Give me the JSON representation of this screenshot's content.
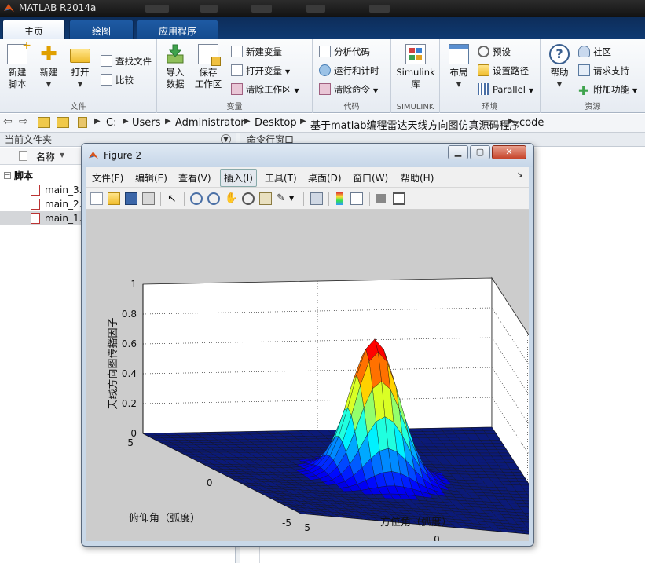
{
  "app": {
    "title": "MATLAB R2014a"
  },
  "tabs": [
    {
      "label": "主页"
    },
    {
      "label": "绘图"
    },
    {
      "label": "应用程序"
    }
  ],
  "ribbon": {
    "file": {
      "label": "文件",
      "new_script": "新建\n脚本",
      "new": "新建",
      "open": "打开",
      "find_files": "查找文件",
      "compare": "比较"
    },
    "variable": {
      "label": "变量",
      "import": "导入\n数据",
      "save_ws": "保存\n工作区",
      "new_var": "新建变量",
      "open_var": "打开变量",
      "clear_ws": "清除工作区"
    },
    "code": {
      "label": "代码",
      "analyze": "分析代码",
      "run_time": "运行和计时",
      "clear_cmd": "清除命令"
    },
    "simulink": {
      "label": "SIMULINK",
      "lib": "Simulink\n库"
    },
    "env": {
      "label": "环境",
      "layout": "布局",
      "prefs": "预设",
      "set_path": "设置路径",
      "parallel": "Parallel"
    },
    "resources": {
      "label": "资源",
      "help": "帮助",
      "community": "社区",
      "support": "请求支持",
      "addons": "附加功能"
    }
  },
  "address": {
    "crumbs": [
      "C:",
      "Users",
      "Administrator",
      "Desktop",
      "基于matlab编程雷达天线方向图仿真源码程序",
      "code"
    ]
  },
  "current_folder": {
    "title": "当前文件夹",
    "col_name": "名称",
    "group": "脚本",
    "files": [
      "main_3.m",
      "main_2.m",
      "main_1.m"
    ]
  },
  "command_window": {
    "title": "命令行窗口"
  },
  "figure": {
    "title": "Figure 2",
    "menus": [
      "文件(F)",
      "编辑(E)",
      "查看(V)",
      "插入(I)",
      "工具(T)",
      "桌面(D)",
      "窗口(W)",
      "帮助(H)"
    ],
    "active_menu_index": 3,
    "toolbar_icons": [
      "new-figure-icon",
      "open-file-icon",
      "save-icon",
      "print-icon",
      "pointer-icon",
      "zoom-in-icon",
      "zoom-out-icon",
      "pan-icon",
      "rotate-icon",
      "data-cursor-icon",
      "brush-icon",
      "link-icon",
      "colorbar-icon",
      "legend-icon",
      "hide-plot-tools-icon",
      "show-plot-tools-icon"
    ]
  },
  "chart_data": {
    "type": "surface",
    "title": "",
    "zlabel": "天线方向图传播因子",
    "xlabel": "方位角（弧度）",
    "ylabel": "俯仰角（弧度）",
    "z_ticks": [
      "0",
      "0.2",
      "0.4",
      "0.6",
      "0.8",
      "1"
    ],
    "x_ticks": [
      "-5",
      "0",
      "5"
    ],
    "y_ticks": [
      "-5",
      "0",
      "5"
    ],
    "xlim": [
      -5,
      5
    ],
    "ylim": [
      -5,
      5
    ],
    "zlim": [
      0,
      1
    ],
    "peak": {
      "x": 0,
      "y": 0,
      "z": 0.93
    },
    "colormap": "jet",
    "grid": true
  }
}
